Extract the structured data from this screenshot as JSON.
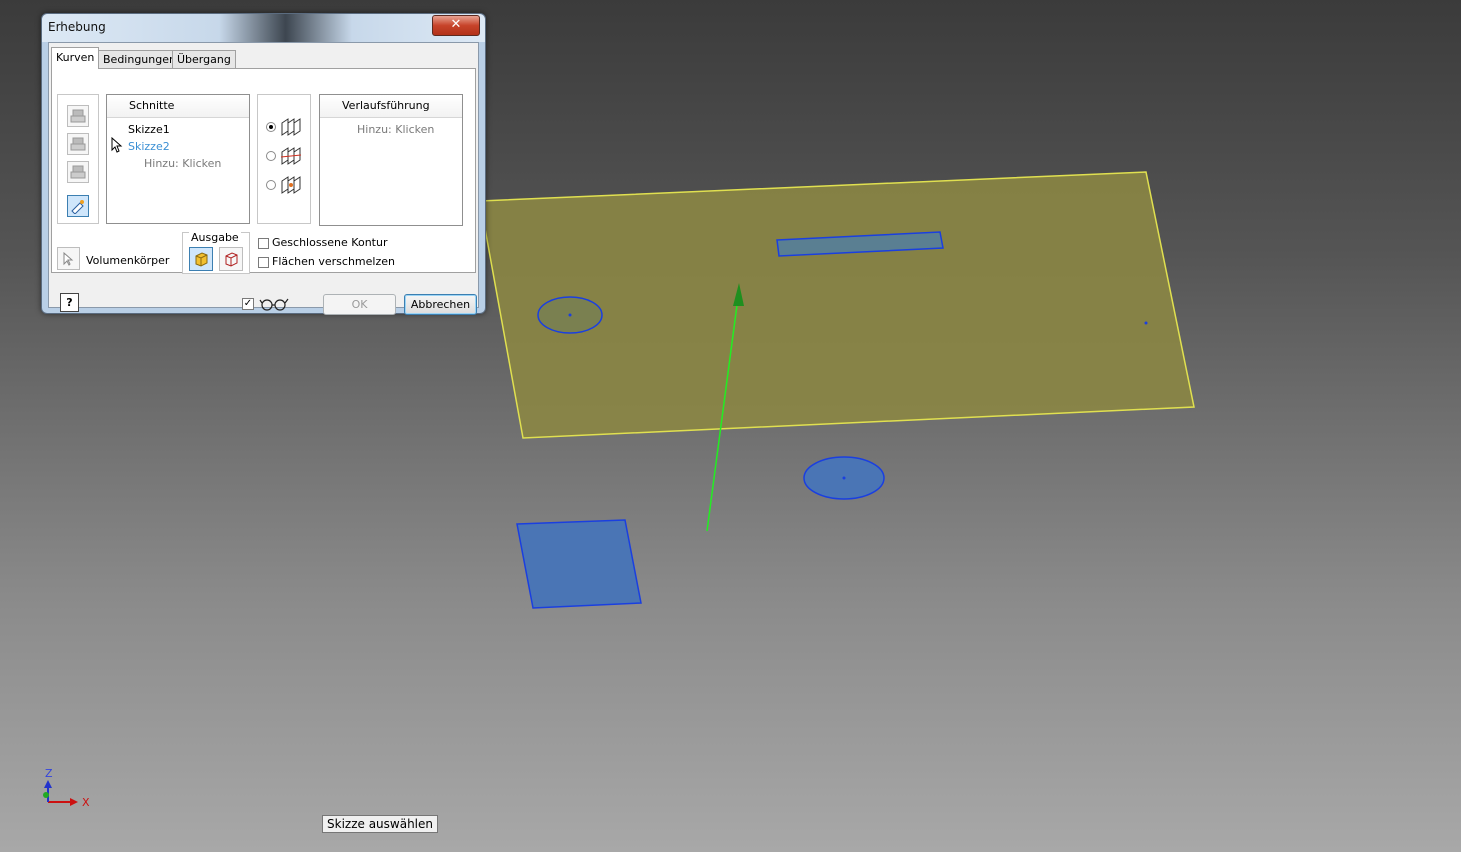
{
  "dialog": {
    "title": "Erhebung",
    "close_glyph": "✕",
    "tabs": [
      {
        "label": "Kurven",
        "active": true
      },
      {
        "label": "Bedingungen",
        "active": false
      },
      {
        "label": "Übergang",
        "active": false
      }
    ],
    "sections_list": {
      "header": "Schnitte",
      "items": [
        "Skizze1",
        "Skizze2"
      ],
      "add_hint": "Hinzu: Klicken"
    },
    "rails_list": {
      "header": "Verlaufsführung",
      "add_hint": "Hinzu: Klicken"
    },
    "body_type_label": "Volumenkörper",
    "output_label": "Ausgabe",
    "closed_loop_label": "Geschlossene Kontur",
    "closed_loop_checked": false,
    "merge_faces_label": "Flächen verschmelzen",
    "merge_faces_checked": false,
    "preview_checked": true,
    "ok_label": "OK",
    "cancel_label": "Abbrechen",
    "help_glyph": "?"
  },
  "tooltip": "Skizze auswählen",
  "triad": {
    "x_label": "X",
    "z_label": "Z"
  },
  "colors": {
    "plane_fill": "#8b8644",
    "plane_edge": "#e0e050",
    "sketch_fill": "#4a75b5",
    "sketch_edge": "#1a3fe0",
    "axis_line": "#22ee22",
    "accent": "#3a8fd4"
  },
  "icons": {
    "sections_side_buttons": [
      "move-up-icon",
      "move-down-icon",
      "delete-icon",
      "select-sketch-icon"
    ],
    "mode_options": [
      "rails-mode-icon",
      "center-line-mode-icon",
      "area-loft-mode-icon"
    ],
    "output_options": [
      "solid-output-icon",
      "surface-output-icon"
    ],
    "preview": "glasses-icon"
  }
}
